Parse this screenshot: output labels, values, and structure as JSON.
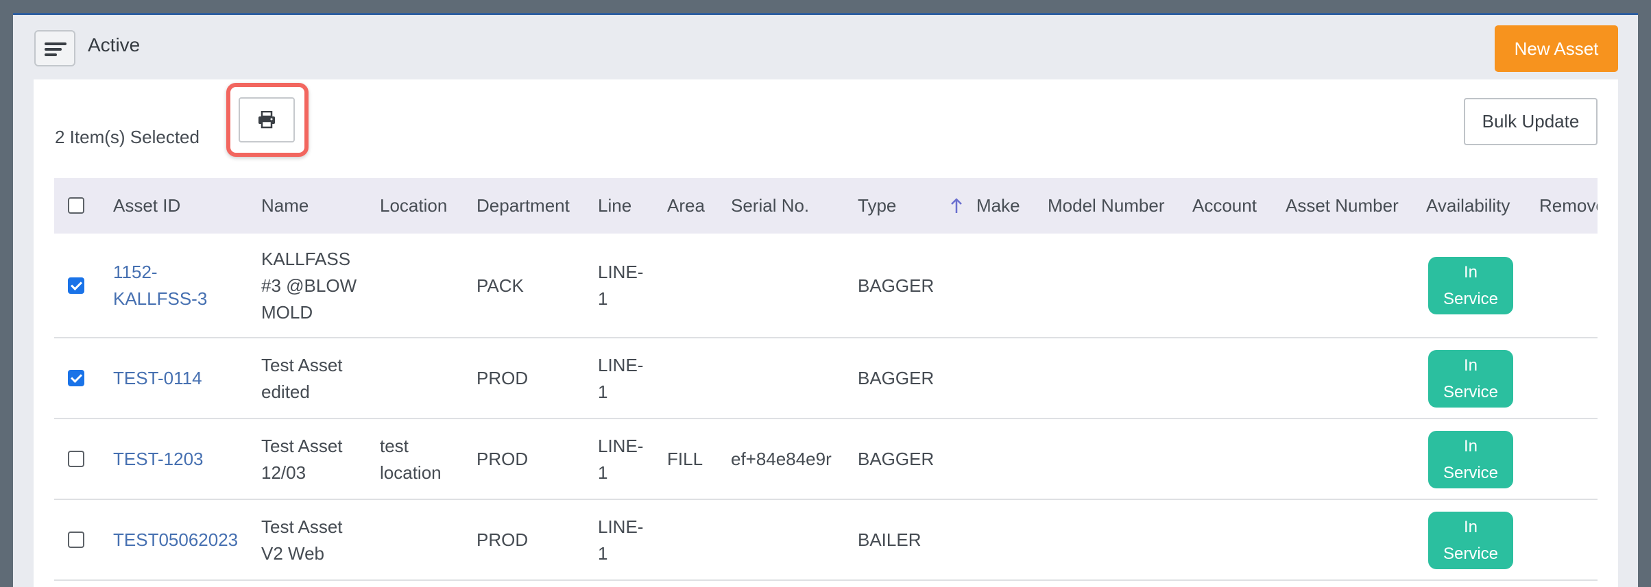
{
  "header": {
    "title": "Active",
    "new_asset_label": "New Asset",
    "menu_icon": "menu-lines-icon"
  },
  "toolbar": {
    "selected_text": "2 Item(s) Selected",
    "print_icon": "printer-icon",
    "bulk_update_label": "Bulk Update"
  },
  "table": {
    "columns": [
      "Asset ID",
      "Name",
      "Location",
      "Department",
      "Line",
      "Area",
      "Serial No.",
      "Type",
      "Make",
      "Model Number",
      "Account",
      "Asset Number",
      "Availability",
      "Remove"
    ],
    "sort_icon": "arrow-up-icon",
    "accent_color": "#2bbf9f",
    "rows": [
      {
        "checked": true,
        "asset_id_1": "1152-",
        "asset_id_2": "KALLFSS-3",
        "name_1": "KALLFASS",
        "name_2": "#3 @BLOW",
        "name_3": "MOLD",
        "location_1": "",
        "location_2": "",
        "department": "PACK",
        "line_1": "LINE-",
        "line_2": "1",
        "area": "",
        "serial": "",
        "type": "BAGGER",
        "status_1": "In",
        "status_2": "Service"
      },
      {
        "checked": true,
        "asset_id_1": "TEST-0114",
        "asset_id_2": "",
        "name_1": "Test Asset",
        "name_2": "edited",
        "name_3": "",
        "location_1": "",
        "location_2": "",
        "department": "PROD",
        "line_1": "LINE-",
        "line_2": "1",
        "area": "",
        "serial": "",
        "type": "BAGGER",
        "status_1": "In",
        "status_2": "Service"
      },
      {
        "checked": false,
        "asset_id_1": "TEST-1203",
        "asset_id_2": "",
        "name_1": "Test Asset",
        "name_2": "12/03",
        "name_3": "",
        "location_1": "test",
        "location_2": "location",
        "department": "PROD",
        "line_1": "LINE-",
        "line_2": "1",
        "area": "FILL",
        "serial": "ef+84e84e9r",
        "type": "BAGGER",
        "status_1": "In",
        "status_2": "Service"
      },
      {
        "checked": false,
        "asset_id_1": "TEST05062023",
        "asset_id_2": "",
        "name_1": "Test Asset",
        "name_2": "V2 Web",
        "name_3": "",
        "location_1": "",
        "location_2": "",
        "department": "PROD",
        "line_1": "LINE-",
        "line_2": "1",
        "area": "",
        "serial": "",
        "type": "BAILER",
        "status_1": "In",
        "status_2": "Service"
      }
    ]
  }
}
